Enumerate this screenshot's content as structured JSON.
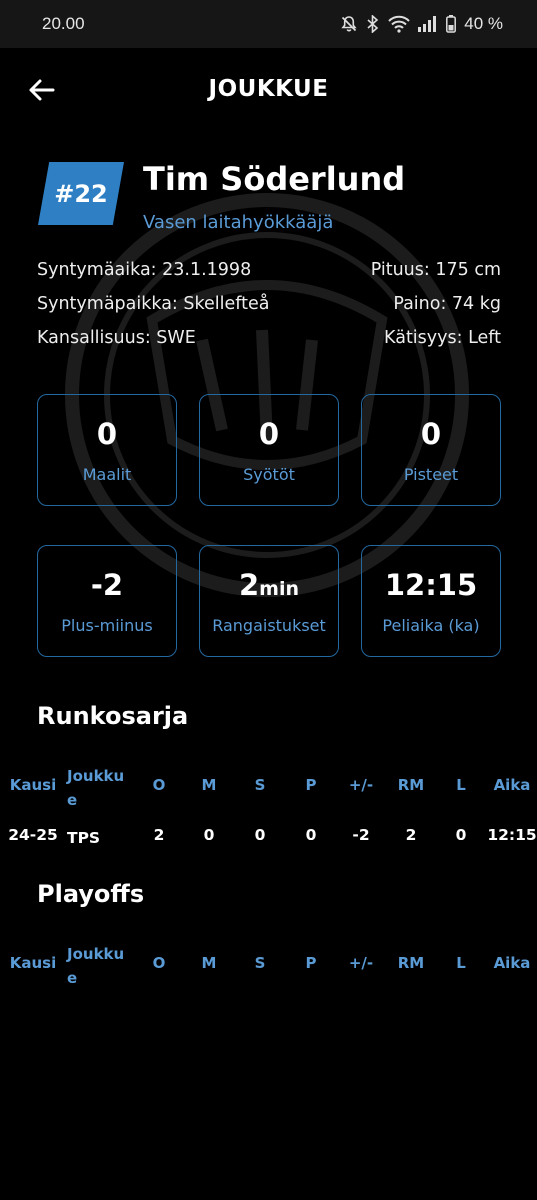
{
  "status_bar": {
    "time": "20.00",
    "battery": "40 %"
  },
  "header": {
    "title": "JOUKKUE"
  },
  "player": {
    "number": "#22",
    "name": "Tim Söderlund",
    "position": "Vasen laitahyökkääjä",
    "info": [
      {
        "left": "Syntymäaika: 23.1.1998",
        "right": "Pituus: 175 cm"
      },
      {
        "left": "Syntymäpaikka: Skellefteå",
        "right": "Paino: 74 kg"
      },
      {
        "left": "Kansallisuus: SWE",
        "right": "Kätisyys: Left"
      }
    ]
  },
  "stats": [
    {
      "value": "0",
      "unit": "",
      "label": "Maalit"
    },
    {
      "value": "0",
      "unit": "",
      "label": "Syötöt"
    },
    {
      "value": "0",
      "unit": "",
      "label": "Pisteet"
    },
    {
      "value": "-2",
      "unit": "",
      "label": "Plus-miinus"
    },
    {
      "value": "2",
      "unit": "min",
      "label": "Rangaistukset"
    },
    {
      "value": "12:15",
      "unit": "",
      "label": "Peliaika (ka)"
    }
  ],
  "regular_season": {
    "title": "Runkosarja",
    "headers": [
      "Kausi",
      "Joukku\ne",
      "O",
      "M",
      "S",
      "P",
      "+/-",
      "RM",
      "L",
      "Aika"
    ],
    "rows": [
      [
        "24-25",
        "TPS",
        "2",
        "0",
        "0",
        "0",
        "-2",
        "2",
        "0",
        "12:15"
      ]
    ]
  },
  "playoffs": {
    "title": "Playoffs",
    "headers": [
      "Kausi",
      "Joukku\ne",
      "O",
      "M",
      "S",
      "P",
      "+/-",
      "RM",
      "L",
      "Aika"
    ],
    "rows": []
  },
  "colors": {
    "accent": "#2f7fc4",
    "label_blue": "#5a9bd6",
    "card_border": "#23689f",
    "background": "#000000"
  }
}
